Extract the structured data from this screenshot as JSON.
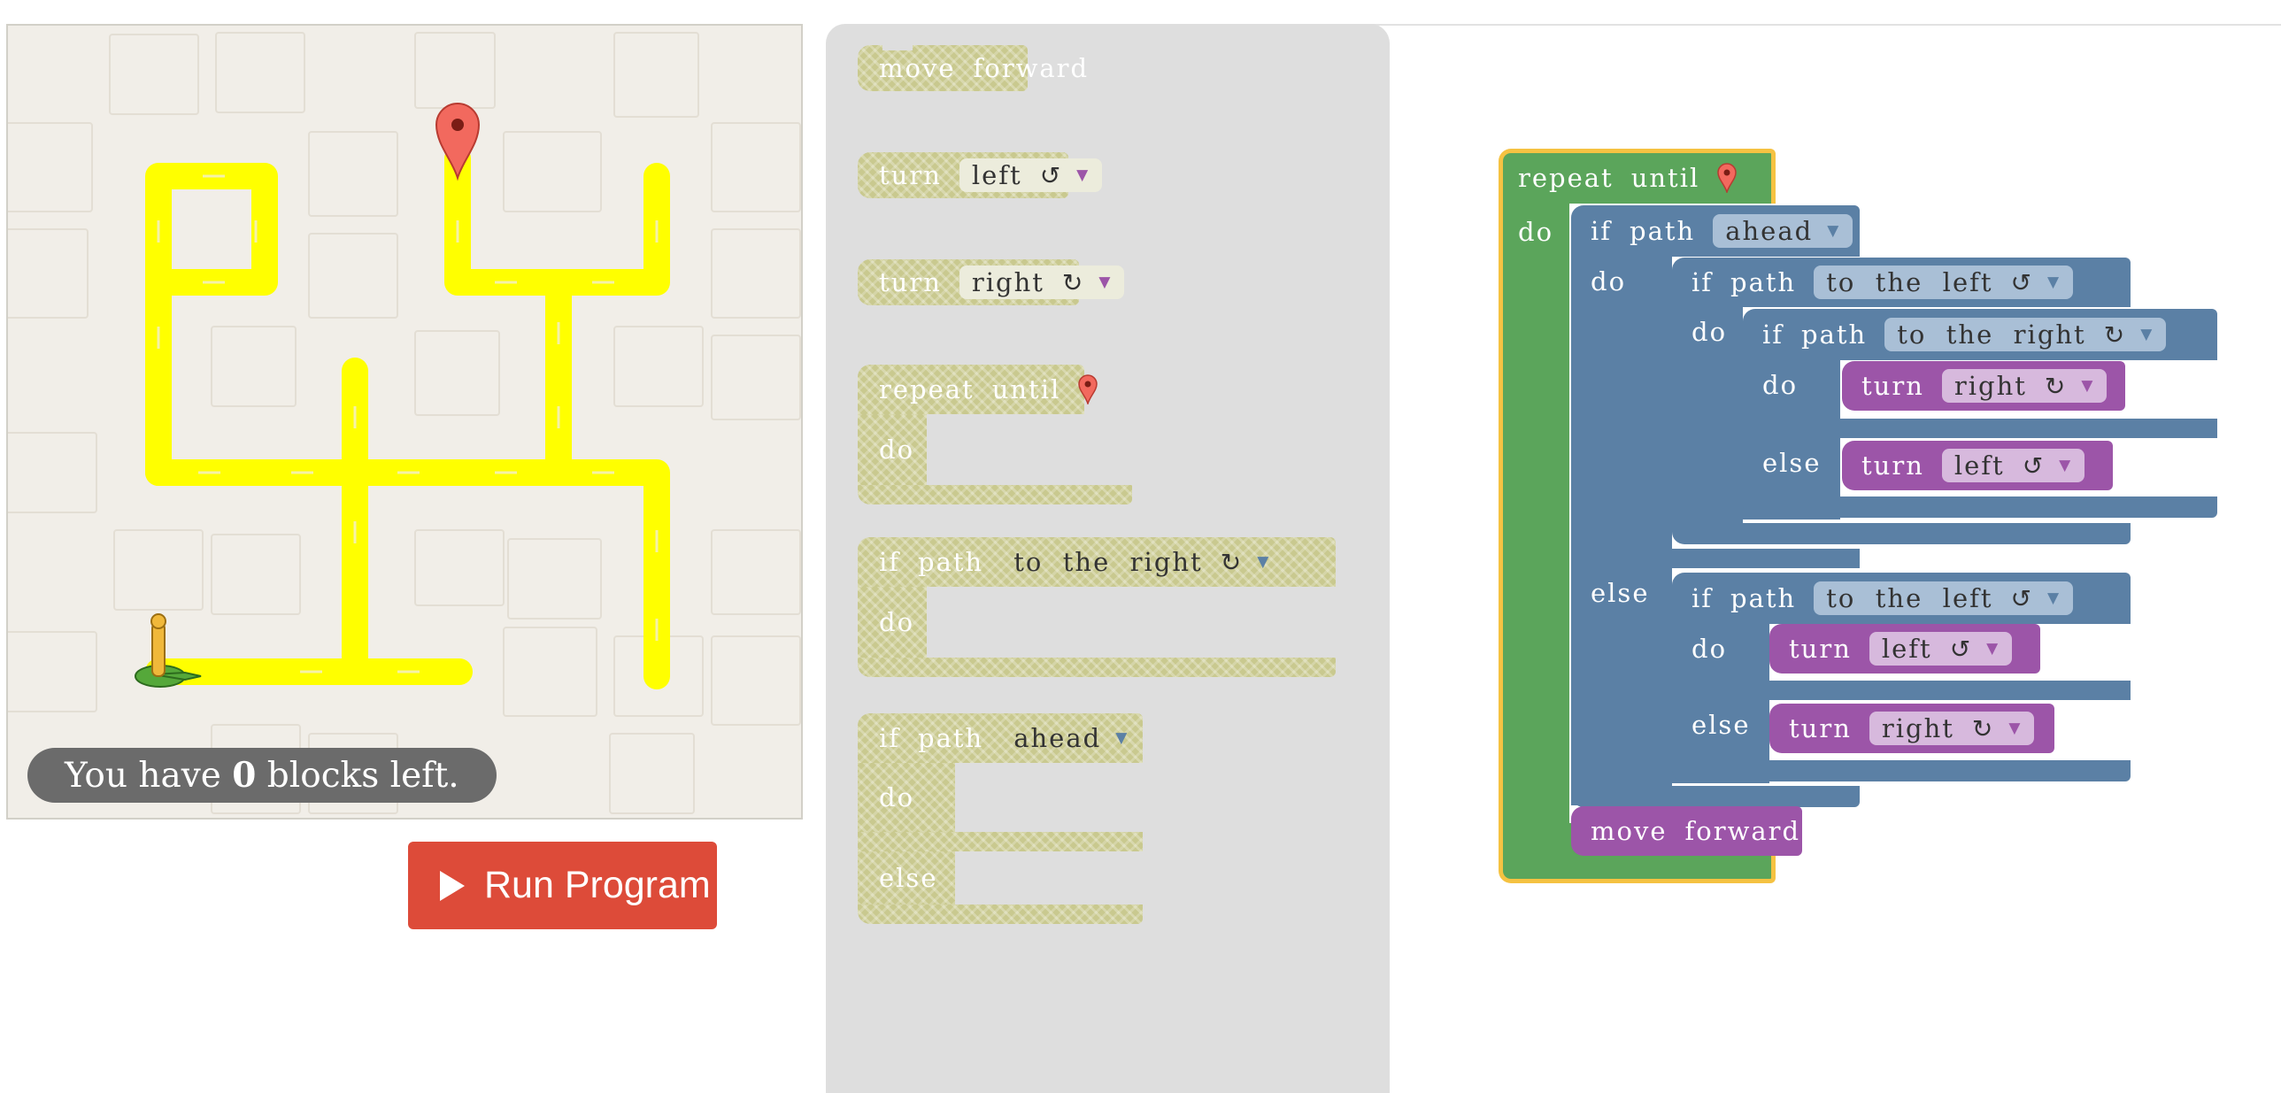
{
  "maze": {
    "status_prefix": "You have",
    "blocks_left": "0",
    "status_suffix": "blocks left."
  },
  "run_button": {
    "label": "Run Program"
  },
  "toolbox": {
    "move_forward": {
      "w1": "move",
      "w2": "forward"
    },
    "turn_left": {
      "w1": "turn",
      "dd": "left",
      "rot": "↺"
    },
    "turn_right": {
      "w1": "turn",
      "dd": "right",
      "rot": "↻"
    },
    "repeat_until": {
      "w1": "repeat",
      "w2": "until",
      "do": "do"
    },
    "if_path_right": {
      "w1": "if",
      "w2": "path",
      "dd": "to  the  right",
      "rot": "↻",
      "do": "do"
    },
    "if_path_ahead": {
      "w1": "if",
      "w2": "path",
      "dd": "ahead",
      "do": "do",
      "else": "else"
    }
  },
  "workspace": {
    "repeat": {
      "w1": "repeat",
      "w2": "until",
      "do": "do"
    },
    "if_ahead": {
      "w1": "if",
      "w2": "path",
      "dd": "ahead",
      "do": "do",
      "else": "else"
    },
    "if_left_1": {
      "w1": "if",
      "w2": "path",
      "dd": "to  the  left",
      "rot": "↺",
      "do": "do"
    },
    "if_right": {
      "w1": "if",
      "w2": "path",
      "dd": "to  the  right",
      "rot": "↻",
      "do": "do",
      "else": "else"
    },
    "turn_right_1": {
      "w1": "turn",
      "dd": "right",
      "rot": "↻"
    },
    "turn_left_1": {
      "w1": "turn",
      "dd": "left",
      "rot": "↺"
    },
    "if_left_2": {
      "w1": "if",
      "w2": "path",
      "dd": "to  the  left",
      "rot": "↺",
      "do": "do",
      "else": "else"
    },
    "turn_left_2": {
      "w1": "turn",
      "dd": "left",
      "rot": "↺"
    },
    "turn_right_2": {
      "w1": "turn",
      "dd": "right",
      "rot": "↻"
    },
    "move_forward": {
      "w1": "move",
      "w2": "forward"
    }
  },
  "colors": {
    "path": "#ffff00",
    "run_button": "#dd4b39",
    "loop_block": "#5ba55b",
    "logic_block": "#5b80a5",
    "movement_block": "#9c55a8",
    "selection_outline": "#f5c242"
  },
  "icons": [
    "goal-marker-icon",
    "pegman-start-icon",
    "play-icon",
    "rotate-left-icon",
    "rotate-right-icon",
    "dropdown-arrow-icon"
  ]
}
